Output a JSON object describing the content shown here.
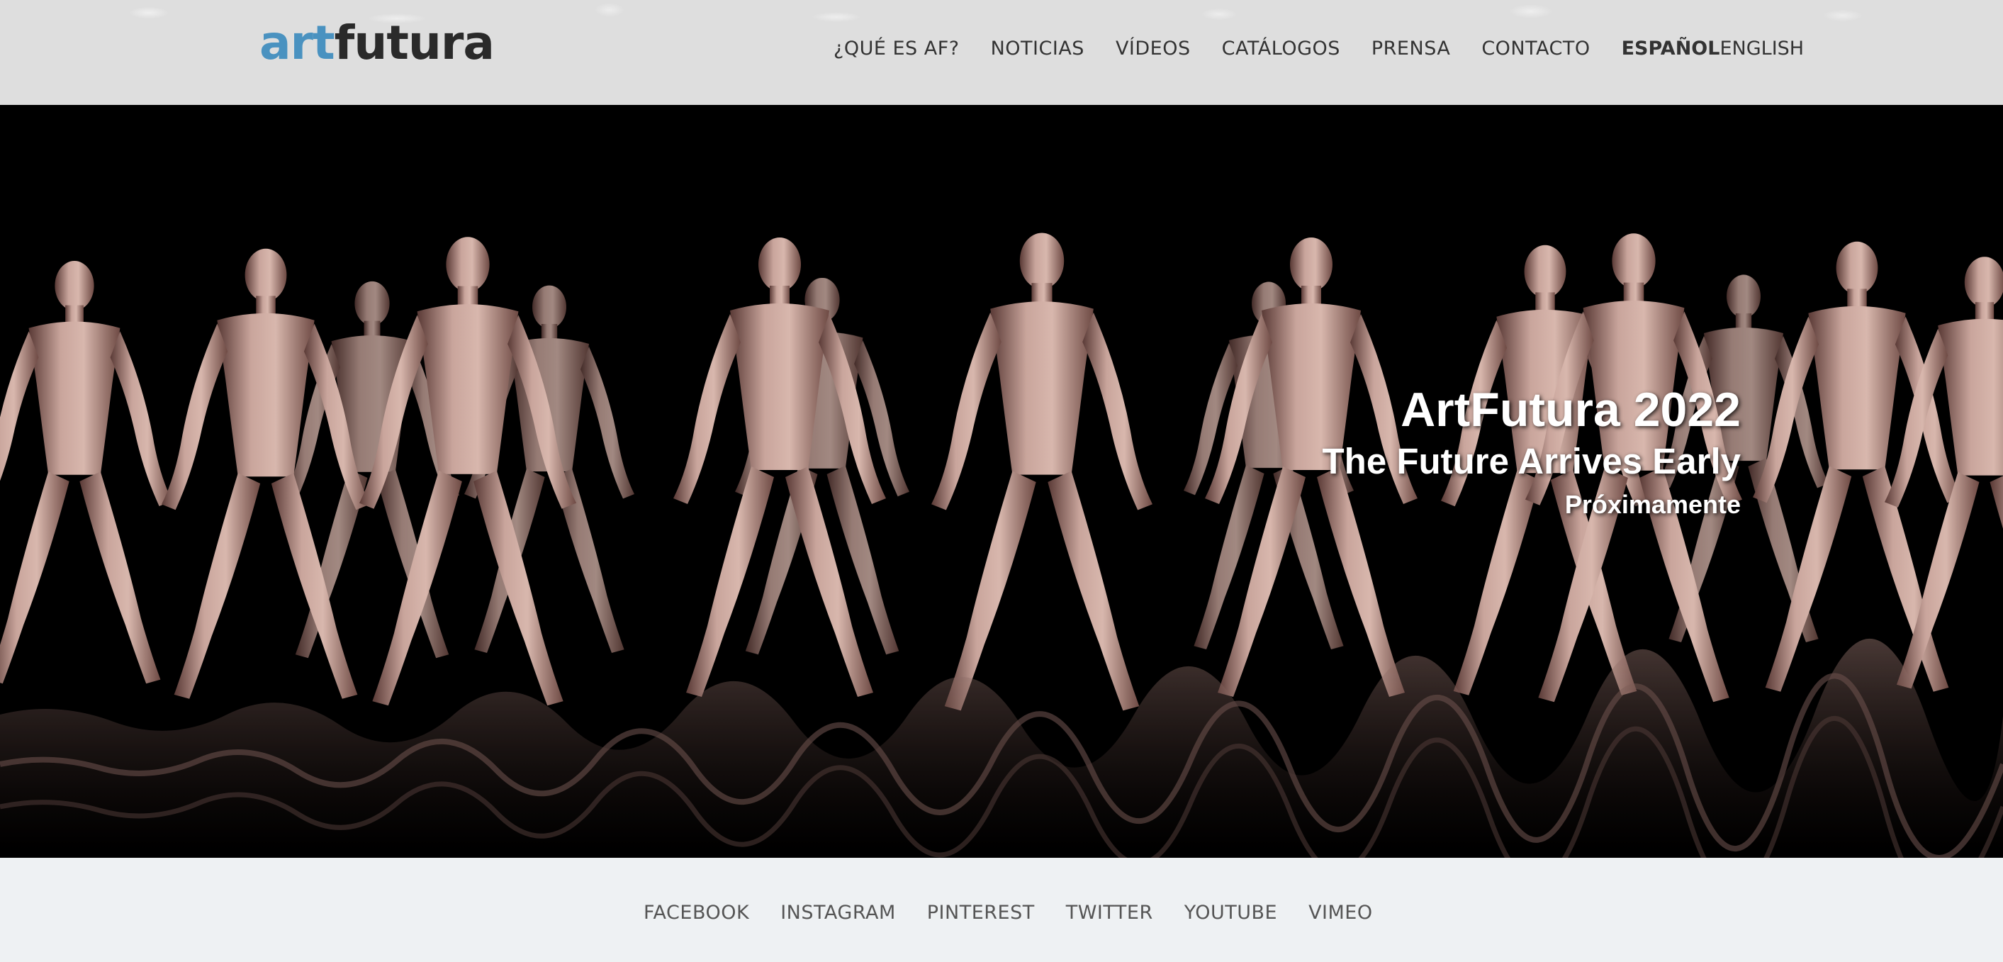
{
  "header": {
    "logo": {
      "part1": "art",
      "part2": "futura"
    },
    "nav": [
      {
        "label": "¿QUÉ ES AF?"
      },
      {
        "label": "NOTICIAS"
      },
      {
        "label": "VÍDEOS"
      },
      {
        "label": "CATÁLOGOS"
      },
      {
        "label": "PRENSA"
      },
      {
        "label": "CONTACTO"
      }
    ],
    "languages": {
      "active": "ESPAÑOL",
      "other": "ENGLISH"
    }
  },
  "hero": {
    "title": "ArtFutura 2022",
    "subtitle": "The Future Arrives Early",
    "note": "Próximamente"
  },
  "footer": {
    "social": [
      {
        "label": "FACEBOOK"
      },
      {
        "label": "INSTAGRAM"
      },
      {
        "label": "PINTEREST"
      },
      {
        "label": "TWITTER"
      },
      {
        "label": "YOUTUBE"
      },
      {
        "label": "VIMEO"
      }
    ]
  },
  "colors": {
    "logo_accent": "#4a92c0",
    "header_bg": "#dedede",
    "footer_bg": "#eef1f3"
  }
}
